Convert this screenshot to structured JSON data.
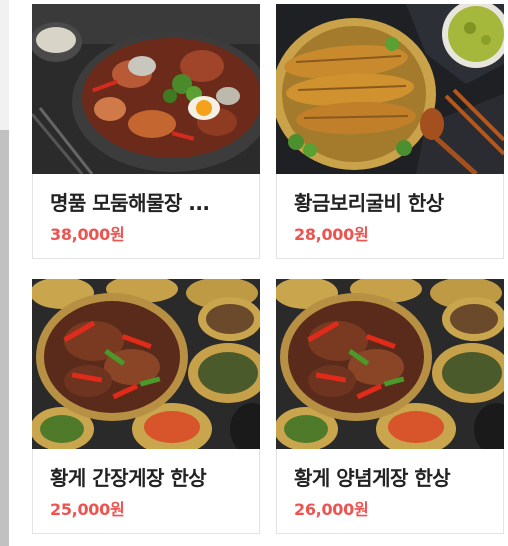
{
  "products": [
    {
      "title": "명품 모둠해물장 ...",
      "price": "38,000원",
      "image": "seafood-jang-hotpot"
    },
    {
      "title": "황금보리굴비 한상",
      "price": "28,000원",
      "image": "dried-yellow-croaker"
    },
    {
      "title": "황게 간장게장 한상",
      "price": "25,000원",
      "image": "soy-marinated-crab"
    },
    {
      "title": "황게 양념게장 한상",
      "price": "26,000원",
      "image": "spicy-marinated-crab"
    }
  ],
  "colors": {
    "price": "#ef5350",
    "title": "#222222",
    "border": "#e3e3e3"
  }
}
